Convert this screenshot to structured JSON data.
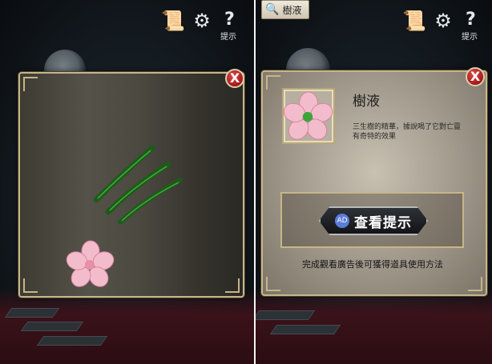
{
  "left_pane": {
    "icons": [
      "scroll-icon",
      "gear-icon",
      "hint-icon"
    ],
    "hint_label": "提示",
    "close": "X"
  },
  "right_pane": {
    "item_tag": {
      "icon": "magnifier-icon",
      "label": "樹液"
    },
    "icons": [
      "scroll-icon",
      "gear-icon",
      "hint-icon"
    ],
    "hint_label": "提示",
    "close": "X",
    "item": {
      "name": "樹液",
      "description": "三生樹的精華，據說喝了它對亡靈有奇特的效果"
    },
    "hint_button": {
      "ad_badge": "AD",
      "label": "查看提示"
    },
    "caption": "完成觀看廣告後可獲得道具使用方法"
  },
  "colors": {
    "frame_gold": "#c7b58a",
    "close_red": "#c21f1f",
    "claw_green": "#2f8a2a"
  }
}
